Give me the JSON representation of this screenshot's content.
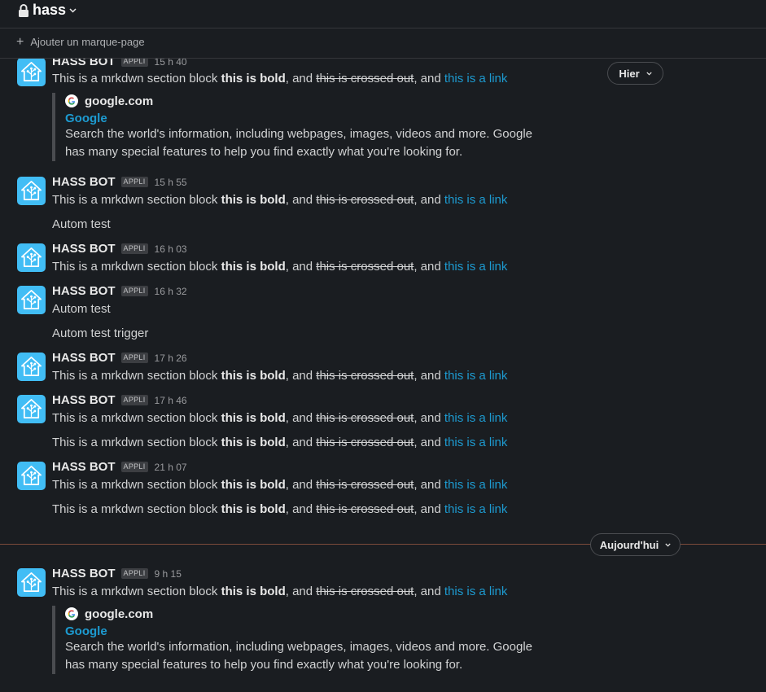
{
  "header": {
    "channel": "hass"
  },
  "bookmarks": {
    "add_label": "Ajouter un marque-page"
  },
  "dates": {
    "yesterday": "Hier",
    "today": "Aujourd'hui"
  },
  "common": {
    "author": "HASS BOT",
    "badge": "APPLI",
    "mrk": {
      "prefix": "This is a mrkdwn section block ",
      "bold": "this is bold",
      "and": ", and ",
      "strike": "this is crossed out",
      "and2": ", and ",
      "link": "this is a link"
    },
    "autom_test": "Autom test",
    "autom_trigger": "Autom test trigger"
  },
  "attachment": {
    "site": "google.com",
    "title": "Google",
    "desc": "Search the world's information, including webpages, images, videos and more. Google has many special features to help you find exactly what you're looking for."
  },
  "times": [
    "15 h 40",
    "15 h 55",
    "16 h 03",
    "16 h 32",
    "17 h 26",
    "17 h 46",
    "21 h 07",
    "9 h 15"
  ]
}
